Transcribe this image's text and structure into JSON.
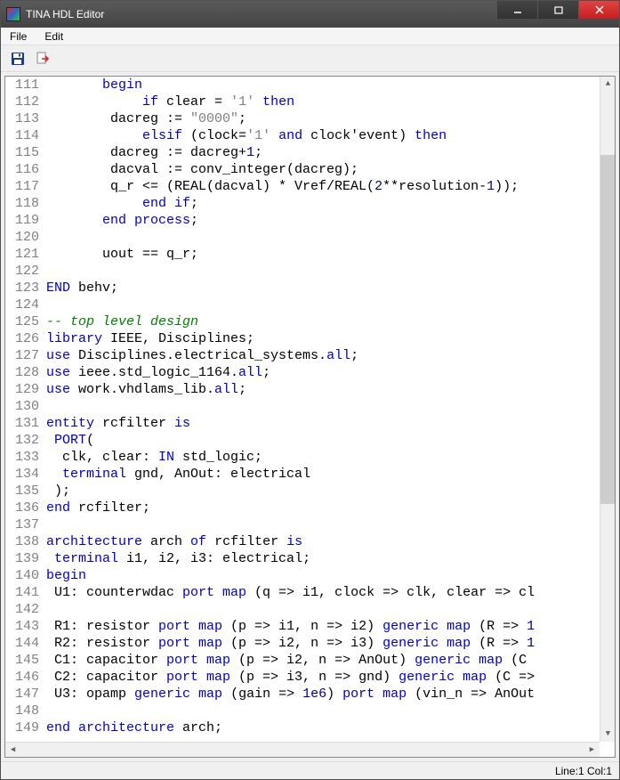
{
  "window": {
    "title": "TINA HDL Editor"
  },
  "menu": {
    "file": "File",
    "edit": "Edit"
  },
  "toolbar": {
    "save": "save-icon",
    "export": "export-icon"
  },
  "status": {
    "position": "Line:1 Col:1"
  },
  "editor": {
    "first_line": 111,
    "lines": [
      {
        "tokens": [
          {
            "t": "       "
          },
          {
            "t": "begin",
            "c": "kw"
          }
        ]
      },
      {
        "tokens": [
          {
            "t": "            "
          },
          {
            "t": "if",
            "c": "kw"
          },
          {
            "t": " clear = "
          },
          {
            "t": "'1'",
            "c": "str"
          },
          {
            "t": " "
          },
          {
            "t": "then",
            "c": "kw"
          }
        ]
      },
      {
        "tokens": [
          {
            "t": "        dacreg := "
          },
          {
            "t": "\"0000\"",
            "c": "str"
          },
          {
            "t": ";"
          }
        ]
      },
      {
        "tokens": [
          {
            "t": "            "
          },
          {
            "t": "elsif",
            "c": "kw"
          },
          {
            "t": " (clock="
          },
          {
            "t": "'1'",
            "c": "str"
          },
          {
            "t": " "
          },
          {
            "t": "and",
            "c": "kw"
          },
          {
            "t": " clock'event) "
          },
          {
            "t": "then",
            "c": "kw"
          }
        ]
      },
      {
        "tokens": [
          {
            "t": "        dacreg := dacreg+"
          },
          {
            "t": "1",
            "c": "num"
          },
          {
            "t": ";"
          }
        ]
      },
      {
        "tokens": [
          {
            "t": "        dacval := conv_integer(dacreg);"
          }
        ]
      },
      {
        "tokens": [
          {
            "t": "        q_r <= (REAL(dacval) * Vref/REAL("
          },
          {
            "t": "2",
            "c": "num"
          },
          {
            "t": "**resolution-"
          },
          {
            "t": "1",
            "c": "num"
          },
          {
            "t": "));"
          }
        ]
      },
      {
        "tokens": [
          {
            "t": "            "
          },
          {
            "t": "end if",
            "c": "kw"
          },
          {
            "t": ";"
          }
        ]
      },
      {
        "tokens": [
          {
            "t": "       "
          },
          {
            "t": "end process",
            "c": "kw"
          },
          {
            "t": ";"
          }
        ]
      },
      {
        "tokens": [
          {
            "t": ""
          }
        ]
      },
      {
        "tokens": [
          {
            "t": "       uout == q_r;"
          }
        ]
      },
      {
        "tokens": [
          {
            "t": ""
          }
        ]
      },
      {
        "tokens": [
          {
            "t": "END",
            "c": "kw"
          },
          {
            "t": " behv;"
          }
        ]
      },
      {
        "tokens": [
          {
            "t": ""
          }
        ]
      },
      {
        "tokens": [
          {
            "t": "-- top level design",
            "c": "cm"
          }
        ]
      },
      {
        "tokens": [
          {
            "t": "library",
            "c": "kw"
          },
          {
            "t": " IEEE, Disciplines;"
          }
        ]
      },
      {
        "tokens": [
          {
            "t": "use",
            "c": "kw"
          },
          {
            "t": " Disciplines.electrical_systems."
          },
          {
            "t": "all",
            "c": "kw"
          },
          {
            "t": ";"
          }
        ]
      },
      {
        "tokens": [
          {
            "t": "use",
            "c": "kw"
          },
          {
            "t": " ieee.std_logic_1164."
          },
          {
            "t": "all",
            "c": "kw"
          },
          {
            "t": ";"
          }
        ]
      },
      {
        "tokens": [
          {
            "t": "use",
            "c": "kw"
          },
          {
            "t": " work.vhdlams_lib."
          },
          {
            "t": "all",
            "c": "kw"
          },
          {
            "t": ";"
          }
        ]
      },
      {
        "tokens": [
          {
            "t": ""
          }
        ]
      },
      {
        "tokens": [
          {
            "t": "entity",
            "c": "kw"
          },
          {
            "t": " rcfilter "
          },
          {
            "t": "is",
            "c": "kw"
          }
        ]
      },
      {
        "tokens": [
          {
            "t": " "
          },
          {
            "t": "PORT",
            "c": "kw"
          },
          {
            "t": "("
          }
        ]
      },
      {
        "tokens": [
          {
            "t": "  clk, clear: "
          },
          {
            "t": "IN",
            "c": "kw"
          },
          {
            "t": " std_logic;"
          }
        ]
      },
      {
        "tokens": [
          {
            "t": "  "
          },
          {
            "t": "terminal",
            "c": "kw"
          },
          {
            "t": " gnd, AnOut: electrical"
          }
        ]
      },
      {
        "tokens": [
          {
            "t": " );"
          }
        ]
      },
      {
        "tokens": [
          {
            "t": "end",
            "c": "kw"
          },
          {
            "t": " rcfilter;"
          }
        ]
      },
      {
        "tokens": [
          {
            "t": ""
          }
        ]
      },
      {
        "tokens": [
          {
            "t": "architecture",
            "c": "kw"
          },
          {
            "t": " arch "
          },
          {
            "t": "of",
            "c": "kw"
          },
          {
            "t": " rcfilter "
          },
          {
            "t": "is",
            "c": "kw"
          }
        ]
      },
      {
        "tokens": [
          {
            "t": " "
          },
          {
            "t": "terminal",
            "c": "kw"
          },
          {
            "t": " i1, i2, i3: electrical;"
          }
        ]
      },
      {
        "tokens": [
          {
            "t": "begin",
            "c": "kw"
          }
        ]
      },
      {
        "tokens": [
          {
            "t": " U1: counterwdac "
          },
          {
            "t": "port map",
            "c": "kw"
          },
          {
            "t": " (q => i1, clock => clk, clear => cl"
          }
        ]
      },
      {
        "tokens": [
          {
            "t": ""
          }
        ]
      },
      {
        "tokens": [
          {
            "t": " R1: resistor "
          },
          {
            "t": "port map",
            "c": "kw"
          },
          {
            "t": " (p => i1, n => i2) "
          },
          {
            "t": "generic map",
            "c": "kw"
          },
          {
            "t": " (R => "
          },
          {
            "t": "1",
            "c": "num"
          }
        ]
      },
      {
        "tokens": [
          {
            "t": " R2: resistor "
          },
          {
            "t": "port map",
            "c": "kw"
          },
          {
            "t": " (p => i2, n => i3) "
          },
          {
            "t": "generic map",
            "c": "kw"
          },
          {
            "t": " (R => "
          },
          {
            "t": "1",
            "c": "num"
          }
        ]
      },
      {
        "tokens": [
          {
            "t": " C1: capacitor "
          },
          {
            "t": "port map",
            "c": "kw"
          },
          {
            "t": " (p => i2, n => AnOut) "
          },
          {
            "t": "generic map",
            "c": "kw"
          },
          {
            "t": " (C "
          }
        ]
      },
      {
        "tokens": [
          {
            "t": " C2: capacitor "
          },
          {
            "t": "port map",
            "c": "kw"
          },
          {
            "t": " (p => i3, n => gnd) "
          },
          {
            "t": "generic map",
            "c": "kw"
          },
          {
            "t": " (C =>"
          }
        ]
      },
      {
        "tokens": [
          {
            "t": " U3: opamp "
          },
          {
            "t": "generic map",
            "c": "kw"
          },
          {
            "t": " (gain => "
          },
          {
            "t": "1e6",
            "c": "num"
          },
          {
            "t": ") "
          },
          {
            "t": "port map",
            "c": "kw"
          },
          {
            "t": " (vin_n => AnOut"
          }
        ]
      },
      {
        "tokens": [
          {
            "t": ""
          }
        ]
      },
      {
        "tokens": [
          {
            "t": "end architecture",
            "c": "kw"
          },
          {
            "t": " arch;"
          }
        ]
      }
    ]
  }
}
